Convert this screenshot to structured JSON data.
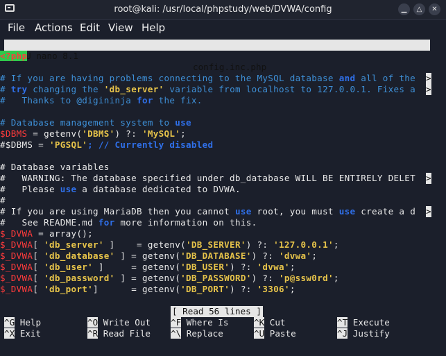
{
  "window": {
    "title": "root@kali: /usr/local/phpstudy/web/DVWA/config"
  },
  "menu": {
    "file": "File",
    "actions": "Actions",
    "edit": "Edit",
    "view": "View",
    "help": "Help"
  },
  "nano": {
    "version": "GNU nano 8.1",
    "filename": "config.inc.php"
  },
  "status": {
    "message": "[ Read 56 lines ]"
  },
  "shortcuts": [
    {
      "key": "^G",
      "label": "Help"
    },
    {
      "key": "^O",
      "label": "Write Out"
    },
    {
      "key": "^F",
      "label": "Where Is"
    },
    {
      "key": "^K",
      "label": "Cut"
    },
    {
      "key": "^T",
      "label": "Execute"
    },
    {
      "key": "^X",
      "label": "Exit"
    },
    {
      "key": "^R",
      "label": "Read File"
    },
    {
      "key": "^\\",
      "label": "Replace"
    },
    {
      "key": "^U",
      "label": "Paste"
    },
    {
      "key": "^J",
      "label": "Justify"
    }
  ],
  "code": {
    "l1": "<?php",
    "l3a": "# If you are having problems connecting to the MySQL database ",
    "l3b": "and",
    "l3c": " all of the",
    "l4a": "# ",
    "l4b": "try",
    "l4c": " changing the ",
    "l4d": "'db_server'",
    "l4e": " variable from localhost to 127.0.0.1. Fixes a",
    "l5a": "#   Thanks to @digininja ",
    "l5b": "for",
    "l5c": " the fix.",
    "l7a": "# Database management system to ",
    "l7b": "use",
    "l8a": "$DBMS",
    "l8b": " = getenv(",
    "l8c": "'DBMS'",
    "l8d": ") ?: ",
    "l8e": "'MySQL'",
    "l8f": ";",
    "l9a": "#$DBMS = ",
    "l9b": "'PGSQL'",
    "l9c": "; // Currently disabled",
    "l11": "# Database variables",
    "l12": "#   WARNING: The database specified under db_database WILL BE ENTIRELY DELET",
    "l13a": "#   Please ",
    "l13b": "use",
    "l13c": " a database dedicated to DVWA.",
    "l14": "#",
    "l15a": "# If you are using MariaDB then you cannot ",
    "l15b": "use",
    "l15c": " root, you must ",
    "l15d": "use",
    "l15e": " create a d",
    "l16a": "#   See README.md ",
    "l16b": "for",
    "l16c": " more information on this.",
    "l17a": "$_DVWA",
    "l17b": " = array();",
    "r1key": "'db_server'",
    "r1pad": " ]    = getenv(",
    "r1env": "'DB_SERVER'",
    "r1val": "'127.0.0.1'",
    "r2key": "'db_database'",
    "r2pad": " ] = getenv(",
    "r2env": "'DB_DATABASE'",
    "r2val": "'dvwa'",
    "r3key": "'db_user'",
    "r3pad": " ]     = getenv(",
    "r3env": "'DB_USER'",
    "r3val": "'dvwa'",
    "r4key": "'db_password'",
    "r4pad": " ] = getenv(",
    "r4env": "'DB_PASSWORD'",
    "r4val": "'p@ssw0rd'",
    "r5key": "'db_port'",
    "r5pad": "]      = getenv(",
    "r5env": "'DB_PORT'",
    "r5val": "'3306'",
    "arrow": ">"
  }
}
